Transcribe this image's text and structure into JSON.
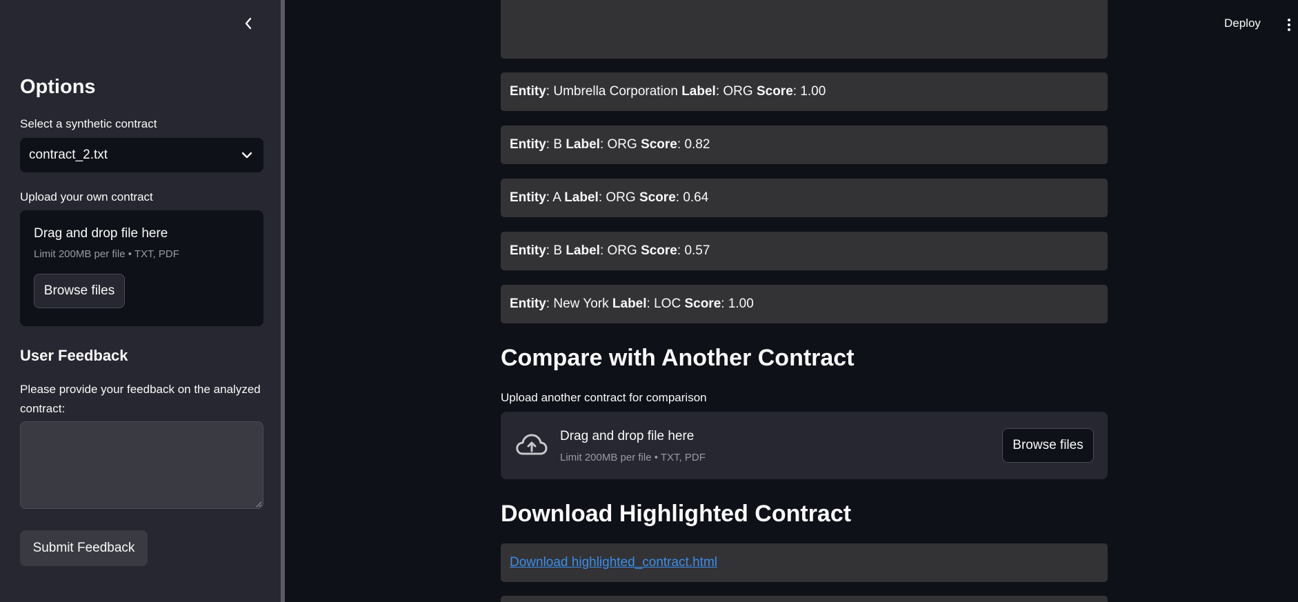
{
  "sidebar": {
    "title": "Options",
    "select_label": "Select a synthetic contract",
    "select_value": "contract_2.txt",
    "upload_label": "Upload your own contract",
    "upload": {
      "title": "Drag and drop file here",
      "subtitle": "Limit 200MB per file • TXT, PDF",
      "button": "Browse files"
    },
    "feedback_heading": "User Feedback",
    "feedback_prompt": "Please provide your feedback on the analyzed contract:",
    "feedback_value": "",
    "submit_button": "Submit Feedback"
  },
  "header": {
    "deploy": "Deploy"
  },
  "main": {
    "entities": [
      {
        "entity_label": "Entity",
        "entity": "Umbrella Corporation",
        "label_label": "Label",
        "label": "ORG",
        "score_label": "Score",
        "score": "1.00"
      },
      {
        "entity_label": "Entity",
        "entity": "B",
        "label_label": "Label",
        "label": "ORG",
        "score_label": "Score",
        "score": "0.82"
      },
      {
        "entity_label": "Entity",
        "entity": "A",
        "label_label": "Label",
        "label": "ORG",
        "score_label": "Score",
        "score": "0.64"
      },
      {
        "entity_label": "Entity",
        "entity": "B",
        "label_label": "Label",
        "label": "ORG",
        "score_label": "Score",
        "score": "0.57"
      },
      {
        "entity_label": "Entity",
        "entity": "New York",
        "label_label": "Label",
        "label": "LOC",
        "score_label": "Score",
        "score": "1.00"
      }
    ],
    "compare_heading": "Compare with Another Contract",
    "compare_label": "Upload another contract for comparison",
    "compare_upload": {
      "title": "Drag and drop file here",
      "subtitle": "Limit 200MB per file • TXT, PDF",
      "button": "Browse files"
    },
    "download_heading": "Download Highlighted Contract",
    "download_link": "Download highlighted_contract.html"
  }
}
